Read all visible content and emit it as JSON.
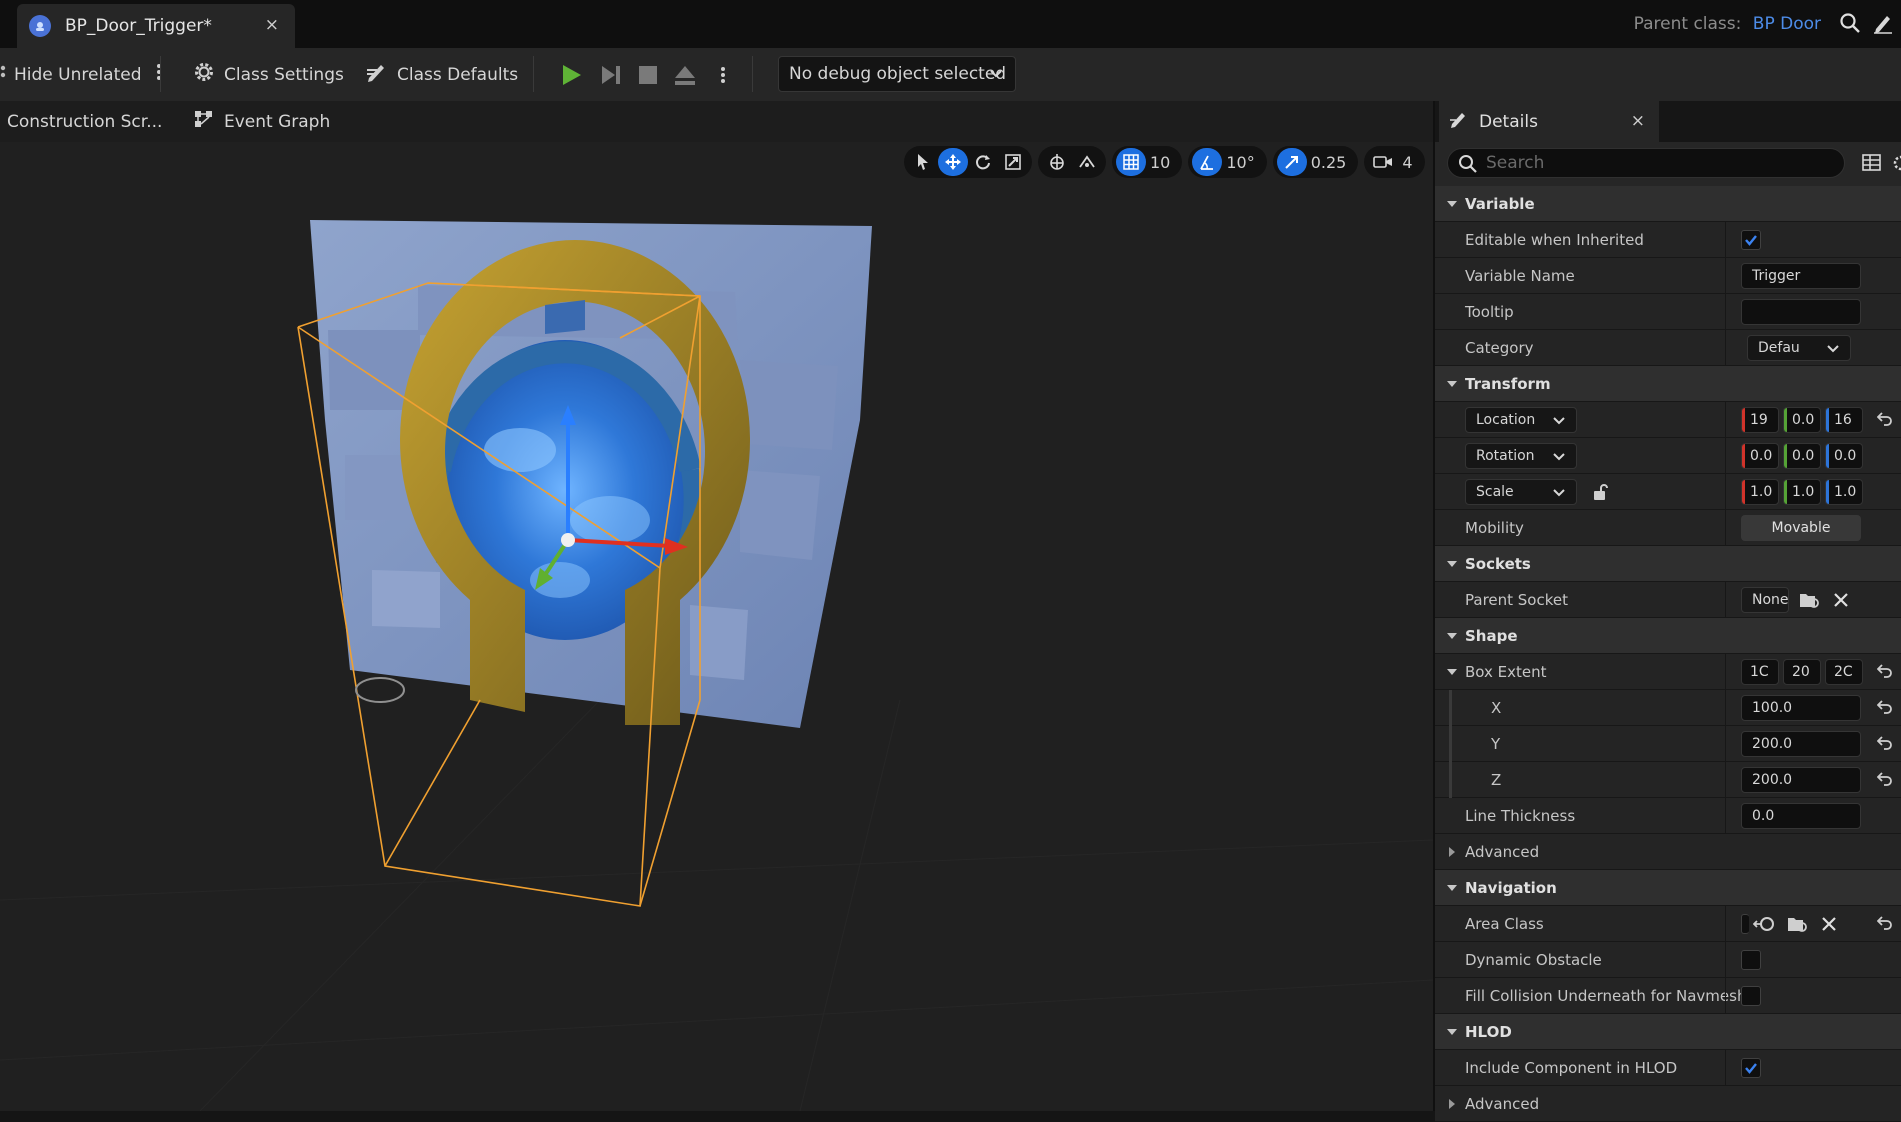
{
  "tab": {
    "title": "BP_Door_Trigger*",
    "close": "×"
  },
  "parent_class": {
    "label": "Parent class:",
    "value": "BP Door"
  },
  "toolbar": {
    "hide_unrelated": "Hide Unrelated",
    "class_settings": "Class Settings",
    "class_defaults": "Class Defaults",
    "debug_object": "No debug object selected"
  },
  "graph_tabs": {
    "construction": "Construction Scr...",
    "event_graph": "Event Graph"
  },
  "viewport": {
    "grid_snap": "10",
    "rotation_snap": "10°",
    "scale_snap": "0.25",
    "camera_speed": "4"
  },
  "details": {
    "title": "Details",
    "close": "×",
    "search_placeholder": "Search",
    "variable": {
      "header": "Variable",
      "editable_label": "Editable when Inherited",
      "editable_checked": true,
      "name_label": "Variable Name",
      "name_value": "Trigger",
      "tooltip_label": "Tooltip",
      "tooltip_value": "",
      "category_label": "Category",
      "category_value": "Defau"
    },
    "transform": {
      "header": "Transform",
      "location_label": "Location",
      "location": [
        "19",
        "0.0",
        "16"
      ],
      "rotation_label": "Rotation",
      "rotation": [
        "0.0",
        "0.0",
        "0.0"
      ],
      "scale_label": "Scale",
      "scale": [
        "1.0",
        "1.0",
        "1.0"
      ],
      "mobility_label": "Mobility",
      "mobility_value": "Movable"
    },
    "sockets": {
      "header": "Sockets",
      "parent_label": "Parent Socket",
      "parent_value": "None"
    },
    "shape": {
      "header": "Shape",
      "box_extent_label": "Box Extent",
      "box_extent": [
        "1C",
        "20",
        "2C"
      ],
      "x_label": "X",
      "x_value": "100.0",
      "y_label": "Y",
      "y_value": "200.0",
      "z_label": "Z",
      "z_value": "200.0",
      "line_thickness_label": "Line Thickness",
      "line_thickness_value": "0.0",
      "advanced": "Advanced"
    },
    "navigation": {
      "header": "Navigation",
      "area_class_label": "Area Class",
      "dynamic_obstacle_label": "Dynamic Obstacle",
      "fill_collision_label": "Fill Collision Underneath for Navmesh"
    },
    "hlod": {
      "header": "HLOD",
      "include_label": "Include Component in HLOD",
      "include_checked": true,
      "advanced": "Advanced"
    }
  },
  "colors": {
    "accent": "#1d6fe0",
    "link": "#4d8ce8",
    "play": "#5fb336",
    "selection": "#f0a030"
  }
}
